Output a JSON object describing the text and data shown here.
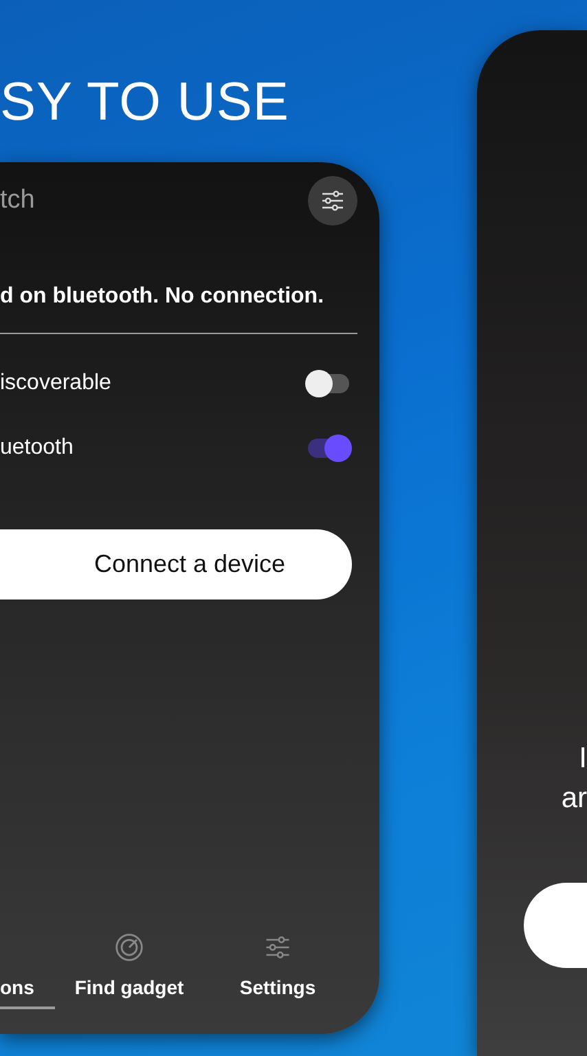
{
  "headline": "SY TO USE",
  "phone": {
    "title": "tch",
    "status": "d on bluetooth. No connection.",
    "settings": [
      {
        "label": "iscoverable",
        "on": false
      },
      {
        "label": "uetooth",
        "on": true
      }
    ],
    "connect_button": "Connect a device",
    "tabs": [
      {
        "label": "ons",
        "kind": "none",
        "selected": true
      },
      {
        "label": "Find gadget",
        "kind": "radar",
        "selected": false
      },
      {
        "label": "Settings",
        "kind": "sliders",
        "selected": false
      }
    ]
  },
  "second_phone": {
    "lines": [
      "I",
      "ar"
    ]
  }
}
